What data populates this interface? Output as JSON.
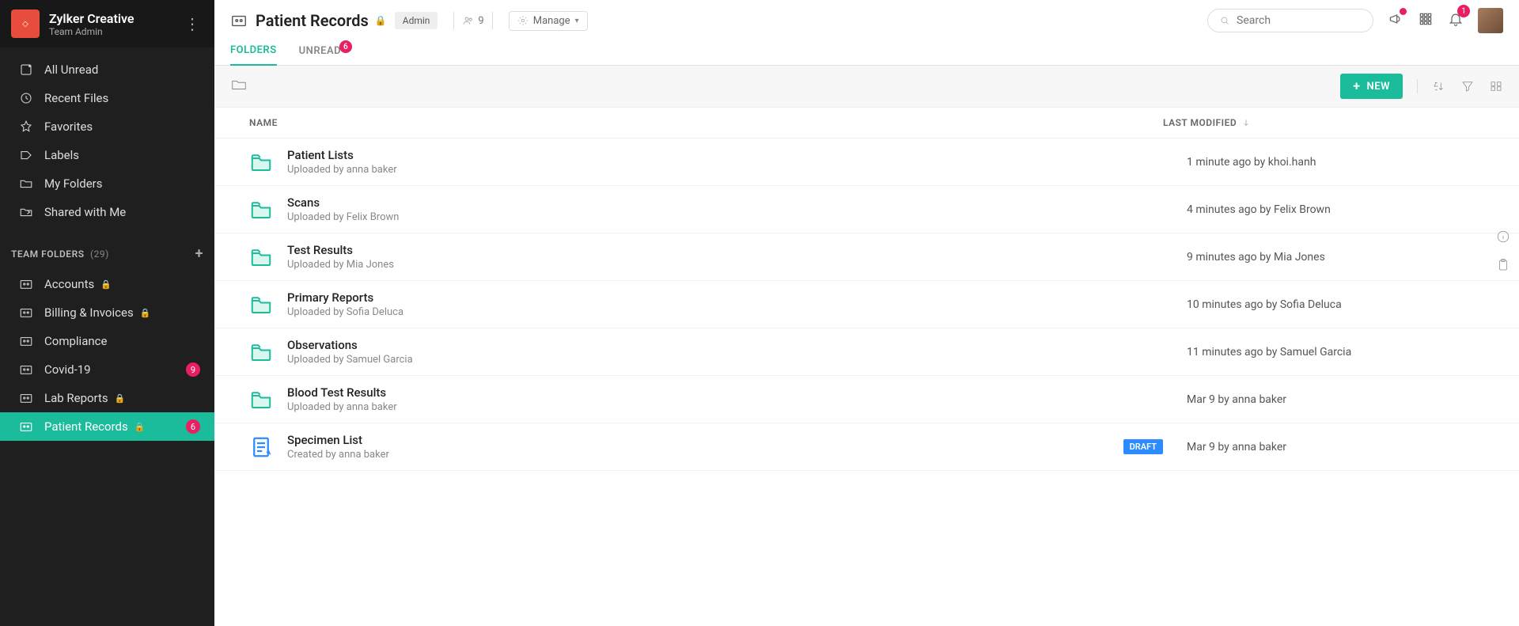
{
  "brand": {
    "title": "Zylker Creative",
    "subtitle": "Team Admin"
  },
  "sidebar": {
    "nav": [
      {
        "label": "All Unread"
      },
      {
        "label": "Recent Files"
      },
      {
        "label": "Favorites"
      },
      {
        "label": "Labels"
      },
      {
        "label": "My Folders"
      },
      {
        "label": "Shared with Me"
      }
    ],
    "section_title": "TEAM FOLDERS",
    "section_count": "(29)",
    "team": [
      {
        "label": "Accounts",
        "locked": true
      },
      {
        "label": "Billing & Invoices",
        "locked": true
      },
      {
        "label": "Compliance"
      },
      {
        "label": "Covid-19",
        "badge": "9"
      },
      {
        "label": "Lab Reports",
        "locked": true
      },
      {
        "label": "Patient Records",
        "locked": true,
        "badge": "6",
        "active": true
      }
    ]
  },
  "header": {
    "title": "Patient Records",
    "role": "Admin",
    "members": "9",
    "manage": "Manage",
    "search_placeholder": "Search",
    "bell_badge": "1"
  },
  "tabs": {
    "folders": "FOLDERS",
    "unread": "UNREAD",
    "unread_badge": "6"
  },
  "toolbar": {
    "new": "NEW"
  },
  "columns": {
    "name": "NAME",
    "modified": "LAST MODIFIED"
  },
  "rows": [
    {
      "title": "Patient Lists",
      "sub": "Uploaded by anna baker",
      "modified": "1 minute ago by khoi.hanh",
      "type": "folder"
    },
    {
      "title": "Scans",
      "sub": "Uploaded by Felix Brown",
      "modified": "4 minutes ago by Felix Brown",
      "type": "folder"
    },
    {
      "title": "Test Results",
      "sub": "Uploaded by Mia Jones",
      "modified": "9 minutes ago by Mia Jones",
      "type": "folder"
    },
    {
      "title": "Primary Reports",
      "sub": "Uploaded by Sofia Deluca",
      "modified": "10 minutes ago by Sofia Deluca",
      "type": "folder"
    },
    {
      "title": "Observations",
      "sub": "Uploaded by Samuel Garcia",
      "modified": "11 minutes ago by Samuel Garcia",
      "type": "folder"
    },
    {
      "title": "Blood Test Results",
      "sub": "Uploaded by anna baker",
      "modified": "Mar 9 by anna baker",
      "type": "folder"
    },
    {
      "title": "Specimen List",
      "sub": "Created by anna baker",
      "modified": "Mar 9 by anna baker",
      "type": "doc",
      "draft": "DRAFT"
    }
  ]
}
